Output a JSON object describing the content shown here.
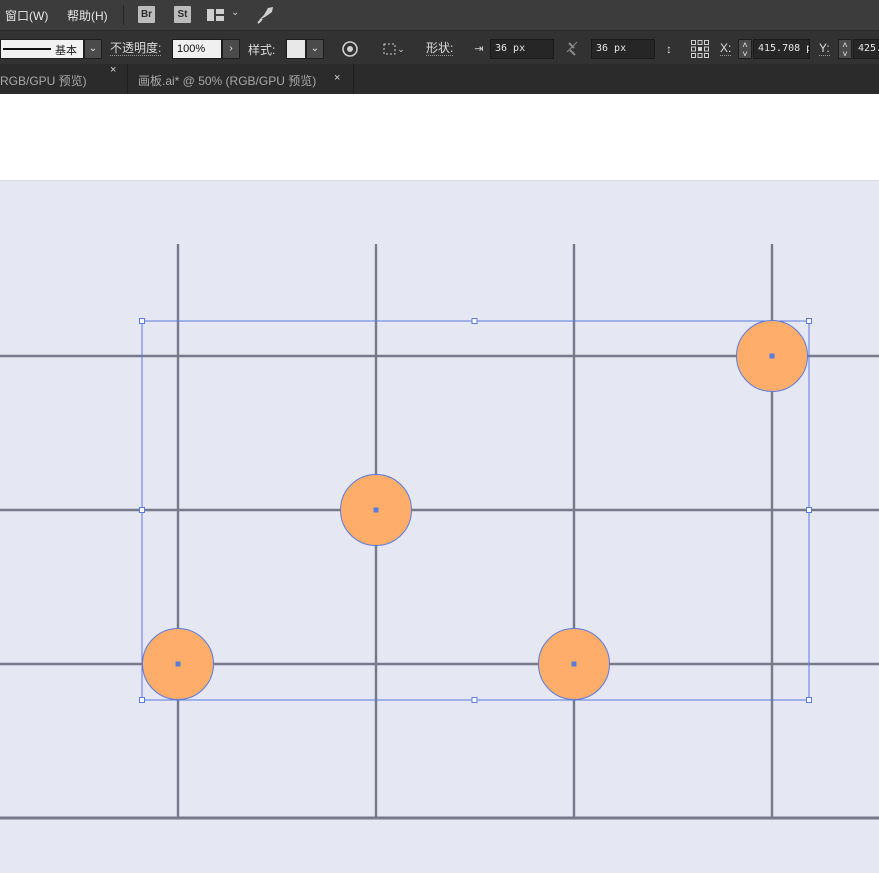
{
  "menubar": {
    "window_menu": "窗口(W)",
    "help_menu": "帮助(H)",
    "bridge_badge": "Br",
    "stock_badge": "St",
    "workspace_icon": "workspace-grid-icon",
    "gpu_icon": "rocket-icon"
  },
  "controlbar": {
    "stroke_style_label": "基本",
    "opacity_label": "不透明度:",
    "opacity_value": "100%",
    "style_label": "样式:",
    "shape_label": "形状:",
    "width_value": "36 px",
    "height_value": "36 px",
    "x_label": "X:",
    "x_value": "415.708 p",
    "y_label": "Y:",
    "y_value": "425."
  },
  "tabs": [
    {
      "label": "(RGB/GPU 预览)",
      "close": "×"
    },
    {
      "label": "画板.ai* @ 50% (RGB/GPU 预览)",
      "close": "×"
    }
  ],
  "artboard": {
    "background": "#e5e7f2",
    "grid_color": "#777a88",
    "circle_fill": "#ffad6a",
    "circle_stroke": "#5a7be0",
    "selection_color": "#5a7be0",
    "circle_count": 4
  }
}
